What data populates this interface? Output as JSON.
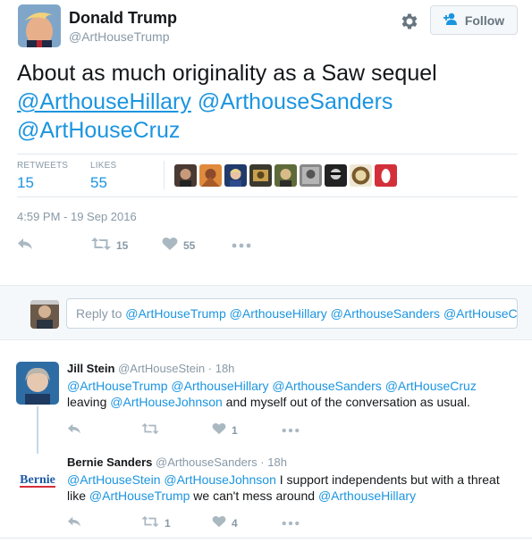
{
  "header": {
    "name": "Donald Trump",
    "handle": "@ArtHouseTrump",
    "follow_label": "Follow"
  },
  "tweet": {
    "text_line1": "About as much originality as a Saw sequel",
    "mention1": "@ArthouseHillary",
    "mention2": "@ArthouseSanders",
    "mention3": "@ArtHouseCruz"
  },
  "stats": {
    "retweets_label": "RETWEETS",
    "retweets_value": "15",
    "likes_label": "LIKES",
    "likes_value": "55"
  },
  "timestamp": "4:59 PM - 19 Sep 2016",
  "actions": {
    "retweet_count": "15",
    "like_count": "55"
  },
  "reply_box": {
    "prefix": "Reply to ",
    "mentions": "@ArtHouseTrump @ArthouseHillary @ArthouseSanders @ArtHouseC"
  },
  "replies": [
    {
      "name": "Jill Stein",
      "handle": "@ArtHouseStein",
      "sep": "·",
      "time": "18h",
      "line1": "@ArtHouseTrump @ArthouseHillary @ArthouseSanders @ArtHouseCruz",
      "line2_mention": "@ArtHouseJohnson",
      "line2_pre": "leaving ",
      "line2_post": " and myself out of the conversation as usual.",
      "retweet_count": "",
      "like_count": "1"
    },
    {
      "name": "Bernie Sanders",
      "handle": "@ArthouseSanders",
      "sep": "·",
      "time": "18h",
      "avatar_text": "Bernie",
      "m1": "@ArtHouseStein",
      "m2": "@ArtHouseJohnson",
      "t1": " I support independents but with a threat",
      "t2": "like ",
      "m3": "@ArtHouseTrump",
      "t3": " we can't mess around ",
      "m4": "@ArthouseHillary",
      "retweet_count": "1",
      "like_count": "4"
    }
  ],
  "colors": {
    "link": "#1b95e0",
    "muted": "#8899a6",
    "like_red": "#e2264d"
  }
}
